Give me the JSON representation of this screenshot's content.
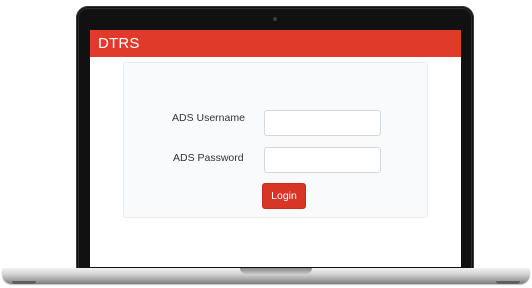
{
  "app": {
    "title": "DTRS",
    "accent_color": "#e03a2a"
  },
  "login_form": {
    "username_label": "ADS Username",
    "username_value": "",
    "password_label": "ADS Password",
    "password_value": "",
    "login_label": "Login"
  },
  "device": {
    "frame": "laptop",
    "camera_icon": "camera-icon"
  }
}
